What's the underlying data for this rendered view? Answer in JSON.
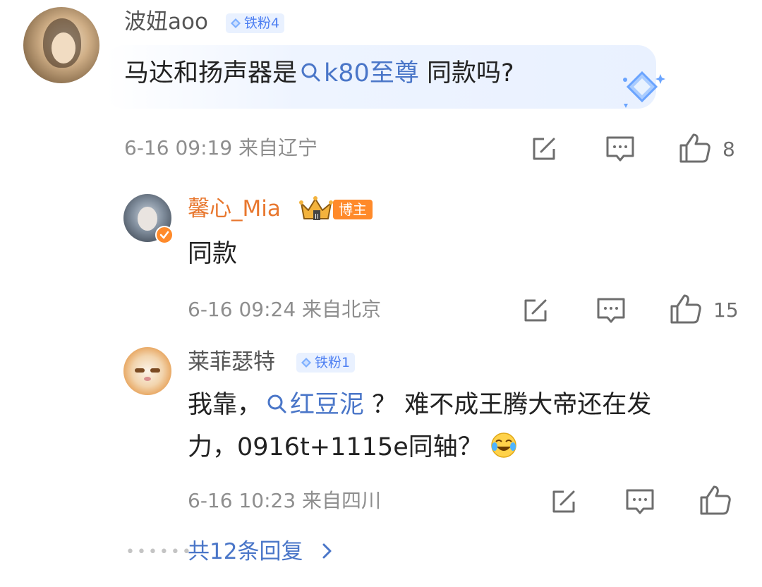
{
  "comment": {
    "user": "波妞aoo",
    "fan_badge": "铁粉4",
    "text_before": "马达和扬声器是",
    "topic_link": "k80至尊",
    "text_after": " 同款吗?",
    "time": "6-16 09:19",
    "location": "来自辽宁",
    "likes": "8"
  },
  "replies": [
    {
      "user": "馨心_Mia",
      "role_badge": "博主",
      "text": "同款",
      "time": "6-16 09:24",
      "location": "来自北京",
      "likes": "15"
    },
    {
      "user": "莱菲瑟特",
      "fan_badge": "铁粉1",
      "text_before": "我靠，",
      "topic_link": "红豆泥",
      "text_after_line1": " ？ 难不成王腾大帝还在发",
      "text_line2": "力，0916t+1115e同轴？",
      "time": "6-16 10:23",
      "location": "来自四川",
      "likes": ""
    }
  ],
  "more_replies": "共12条回复",
  "colors": {
    "link": "#4a76c8",
    "blogger": "#e8772e",
    "fan_badge_bg": "#e9f1ff"
  }
}
